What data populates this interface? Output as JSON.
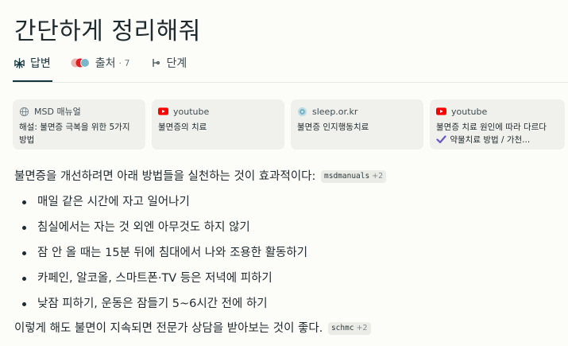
{
  "title": "간단하게 정리해줘",
  "tabs": [
    {
      "label": "답변",
      "icon": "perplexity-icon"
    },
    {
      "label": "출처",
      "count": "· 7",
      "icon": "source-favicons-icon"
    },
    {
      "label": "단계",
      "icon": "steps-icon"
    }
  ],
  "sources": [
    {
      "site": "MSD 매뉴얼",
      "icon": "globe-icon",
      "text": "해설: 불면증 극복을 위한 5가지 방법"
    },
    {
      "site": "youtube",
      "icon": "youtube-icon",
      "text": "불면증의 치료"
    },
    {
      "site": "sleep.or.kr",
      "icon": "sleep-site-icon",
      "text": "불면증 인지행동치료"
    },
    {
      "site": "youtube",
      "icon": "youtube-icon",
      "text_a": "불면증 치료 원인에 따라 다르다",
      "text_b": "약물치료 방법 / 가천..."
    }
  ],
  "answer": {
    "intro": "불면증을 개선하려면 아래 방법들을 실천하는 것이 효과적이다:",
    "intro_cite": {
      "name": "msdmanuals",
      "more": "+2"
    },
    "bullets": [
      "매일 같은 시간에 자고 일어나기",
      "침실에서는 자는 것 외엔 아무것도 하지 않기",
      "잠 안 올 때는 15분 뒤에 침대에서 나와 조용한 활동하기",
      "카페인, 알코올, 스마트폰·TV 등은 저녁에 피하기",
      "낮잠 피하기, 운동은 잠들기 5~6시간 전에 하기"
    ],
    "closing": "이렇게 해도 불면이 지속되면 전문가 상담을 받아보는 것이 좋다.",
    "closing_cite": {
      "name": "schmc",
      "more": "+2"
    }
  },
  "colors": {
    "background": "#fcfcf9",
    "text": "#13343b",
    "card": "#f0f0ec",
    "youtube": "#ff0000"
  }
}
